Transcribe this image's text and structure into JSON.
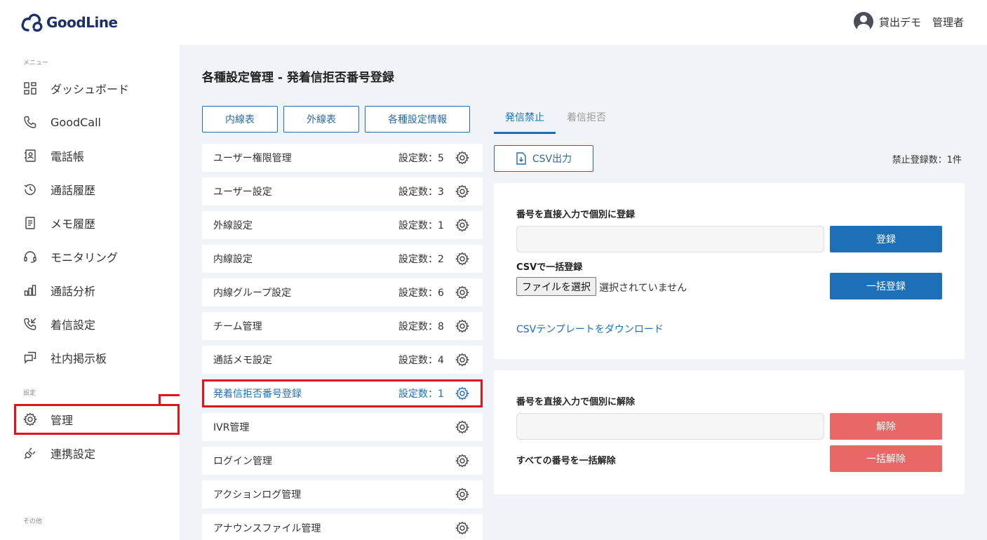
{
  "header": {
    "logo_text": "GoodLine",
    "user_name": "貸出デモ",
    "user_role": "管理者"
  },
  "sidebar": {
    "menu_label": "メニュー",
    "settings_label": "設定",
    "other_label": "その他",
    "items": [
      {
        "label": "ダッシュボード",
        "icon": "dashboard-icon"
      },
      {
        "label": "GoodCall",
        "icon": "phone-icon"
      },
      {
        "label": "電話帳",
        "icon": "phonebook-icon"
      },
      {
        "label": "通話履歴",
        "icon": "history-icon"
      },
      {
        "label": "メモ履歴",
        "icon": "memo-icon"
      },
      {
        "label": "モニタリング",
        "icon": "headset-icon"
      },
      {
        "label": "通話分析",
        "icon": "bar-chart-icon"
      },
      {
        "label": "着信設定",
        "icon": "incoming-call-icon"
      },
      {
        "label": "社内掲示板",
        "icon": "bulletin-icon"
      }
    ],
    "settings_items": [
      {
        "label": "管理",
        "icon": "gear-icon"
      },
      {
        "label": "連携設定",
        "icon": "plug-icon"
      }
    ]
  },
  "main": {
    "title": "各種設定管理 - 発着信拒否番号登録",
    "tabs": [
      "内線表",
      "外線表",
      "各種設定情報"
    ],
    "settings": [
      {
        "label": "ユーザー権限管理",
        "count": "設定数：5"
      },
      {
        "label": "ユーザー設定",
        "count": "設定数：3"
      },
      {
        "label": "外線設定",
        "count": "設定数：1"
      },
      {
        "label": "内線設定",
        "count": "設定数：2"
      },
      {
        "label": "内線グループ設定",
        "count": "設定数：6"
      },
      {
        "label": "チーム管理",
        "count": "設定数：8"
      },
      {
        "label": "通話メモ設定",
        "count": "設定数：4"
      },
      {
        "label": "発着信拒否番号登録",
        "count": "設定数：1"
      },
      {
        "label": "IVR管理",
        "count": ""
      },
      {
        "label": "ログイン管理",
        "count": ""
      },
      {
        "label": "アクションログ管理",
        "count": ""
      },
      {
        "label": "アナウンスファイル管理",
        "count": ""
      }
    ]
  },
  "panel": {
    "sub_tabs": [
      "発信禁止",
      "着信拒否"
    ],
    "csv_export": "CSV出力",
    "ban_count": "禁止登録数：1件",
    "register_card": {
      "direct_label": "番号を直接入力で個別に登録",
      "register_button": "登録",
      "csv_label": "CSVで一括登録",
      "file_button": "ファイルを選択",
      "file_status": "選択されていません",
      "bulk_register_button": "一括登録",
      "template_link": "CSVテンプレートをダウンロード"
    },
    "release_card": {
      "direct_label": "番号を直接入力で個別に解除",
      "release_button": "解除",
      "all_label": "すべての番号を一括解除",
      "bulk_release_button": "一括解除"
    }
  },
  "colors": {
    "accent": "#1d6fb8",
    "danger": "#e86868",
    "highlight": "#e0141a",
    "main_bg": "#f0f4f8"
  }
}
